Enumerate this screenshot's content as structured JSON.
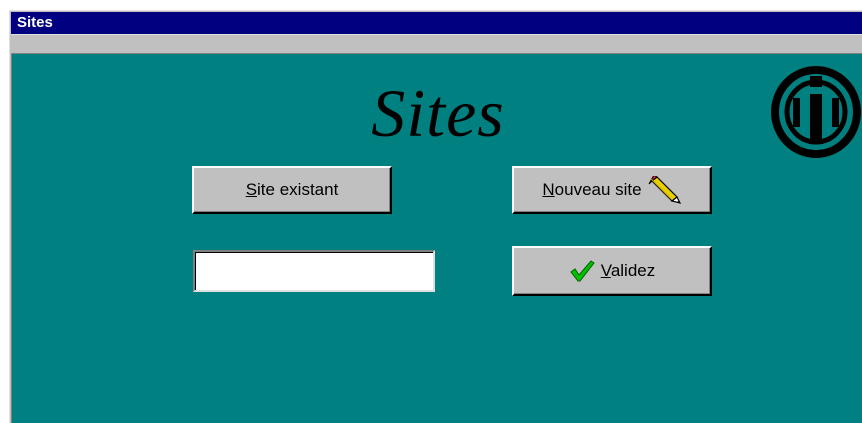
{
  "window": {
    "title": "Sites"
  },
  "main": {
    "heading": "Sites",
    "buttons": {
      "existing_site": {
        "mnemonic": "S",
        "rest": "ite existant"
      },
      "new_site": {
        "mnemonic": "N",
        "rest": "ouveau site",
        "icon": "pencil-icon"
      },
      "validate": {
        "mnemonic": "V",
        "rest": "alidez",
        "icon": "checkmark-icon"
      }
    },
    "site_input": {
      "value": "",
      "placeholder": ""
    }
  },
  "logo": {
    "icon": "logo-icon"
  },
  "colors": {
    "title_bar": "#000080",
    "client_bg": "#008080",
    "button_face": "#c0c0c0",
    "checkmark": "#00c000",
    "pencil": "#e8d000"
  }
}
